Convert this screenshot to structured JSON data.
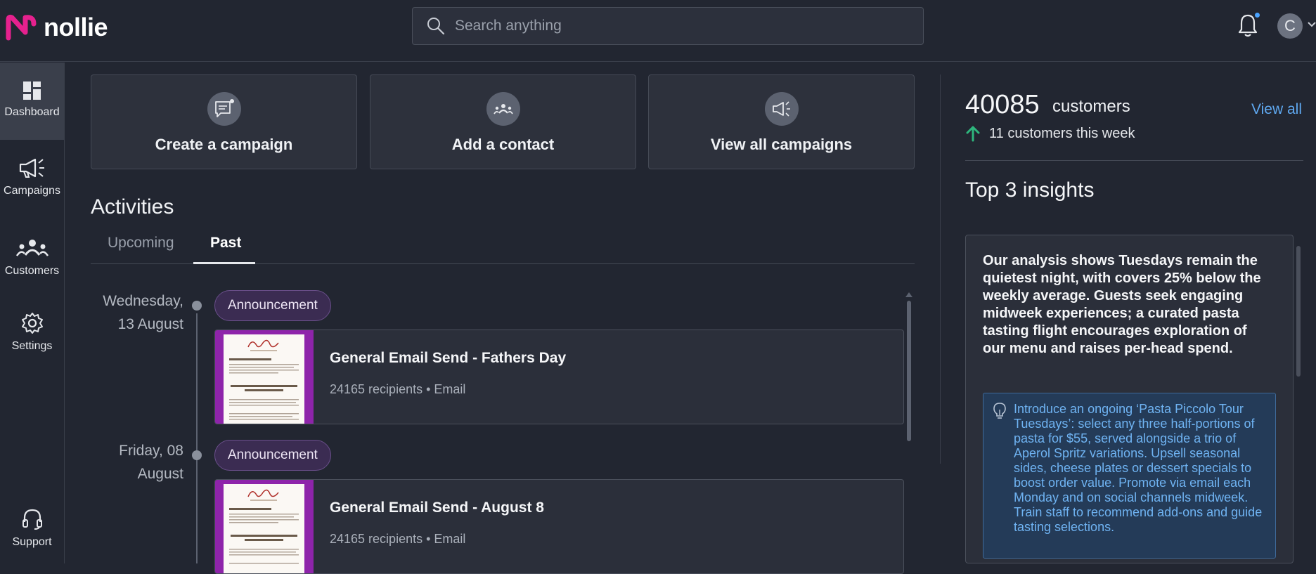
{
  "header": {
    "brand": "nollie",
    "search_placeholder": "Search anything",
    "avatar_initial": "C"
  },
  "sidebar": {
    "items": [
      {
        "label": "Dashboard",
        "icon": "dashboard-icon"
      },
      {
        "label": "Campaigns",
        "icon": "megaphone-icon"
      },
      {
        "label": "Customers",
        "icon": "people-icon"
      },
      {
        "label": "Settings",
        "icon": "gear-icon"
      },
      {
        "label": "Support",
        "icon": "headset-icon"
      }
    ]
  },
  "quick_actions": [
    {
      "label": "Create a campaign",
      "icon": "message-icon"
    },
    {
      "label": "Add a contact",
      "icon": "contacts-icon"
    },
    {
      "label": "View all campaigns",
      "icon": "megaphone-icon"
    }
  ],
  "activities": {
    "title": "Activities",
    "tabs": [
      {
        "label": "Upcoming"
      },
      {
        "label": "Past"
      }
    ],
    "entries": [
      {
        "date_line1": "Wednesday,",
        "date_line2": "13 August",
        "badge": "Announcement",
        "title": "General Email Send - Fathers Day",
        "meta": "24165 recipients • Email"
      },
      {
        "date_line1": "Friday, 08",
        "date_line2": "August",
        "badge": "Announcement",
        "title": "General Email Send - August 8",
        "meta": "24165 recipients • Email"
      }
    ]
  },
  "customers": {
    "count": "40085",
    "label": "customers",
    "view_all": "View all",
    "week_text": "11 customers this week"
  },
  "insights": {
    "title": "Top 3 insights",
    "first_text": "Our analysis shows Tuesdays remain the quietest night, with covers 25% below the weekly average. Guests seek engaging midweek experiences; a curated pasta tasting flight encourages exploration of our menu and raises per-head spend.",
    "first_tip": "Introduce an ongoing ‘Pasta Piccolo Tour Tuesdays’: select any three half-portions of pasta for $55, served alongside a trio of Aperol Spritz variations. Upsell seasonal sides, cheese plates or dessert specials to boost order value. Promote via email each Monday and on social channels midweek. Train staff to recommend add-ons and guide tasting selections."
  },
  "colors": {
    "background": "#222631",
    "card": "#2d313c",
    "brand_pink": "#e6218e",
    "badge": "#3b2c52",
    "link": "#5fa8f0",
    "up_arrow": "#2eb67d",
    "tip_bg": "#243b58"
  }
}
